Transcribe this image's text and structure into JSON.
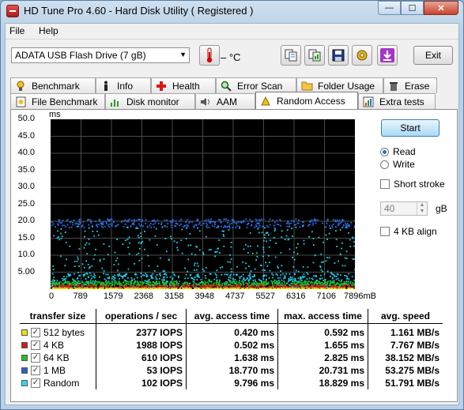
{
  "window": {
    "title": "HD Tune Pro 4.60 - Hard Disk Utility (  Registered )",
    "minimize_glyph": "—",
    "maximize_glyph": "☐",
    "close_glyph": "✕"
  },
  "menu": {
    "file_label": "File",
    "help_label": "Help"
  },
  "toolbar": {
    "drive_selected": "ADATA   USB Flash Drive  (7 gB)",
    "temperature": "– °C",
    "exit_label": "Exit",
    "icons": [
      "thermometer-icon",
      "copy-text-icon",
      "copy-screenshot-icon",
      "save-icon",
      "options-icon",
      "download-icon"
    ]
  },
  "tabs_top": [
    {
      "label": "Benchmark",
      "icon": "benchmark-icon"
    },
    {
      "label": "Info",
      "icon": "info-icon"
    },
    {
      "label": "Health",
      "icon": "health-icon"
    },
    {
      "label": "Error Scan",
      "icon": "error-scan-icon"
    },
    {
      "label": "Folder Usage",
      "icon": "folder-icon"
    },
    {
      "label": "Erase",
      "icon": "erase-icon"
    }
  ],
  "tabs_bottom": [
    {
      "label": "File Benchmark",
      "icon": "file-benchmark-icon"
    },
    {
      "label": "Disk monitor",
      "icon": "disk-monitor-icon"
    },
    {
      "label": "AAM",
      "icon": "aam-icon"
    },
    {
      "label": "Random Access",
      "icon": "random-access-icon",
      "active": true
    },
    {
      "label": "Extra tests",
      "icon": "extra-tests-icon"
    }
  ],
  "controls": {
    "start_label": "Start",
    "read_label": "Read",
    "write_label": "Write",
    "mode_selected": "Read",
    "short_stroke_label": "Short stroke",
    "short_stroke_checked": false,
    "short_stroke_value": "40",
    "short_stroke_unit": "gB",
    "align_label": "4 KB align",
    "align_checked": false
  },
  "chart_data": {
    "type": "scatter",
    "ylabel": "ms",
    "xlabel": "mB",
    "ylim": [
      0,
      50
    ],
    "xlim": [
      0,
      7896
    ],
    "grid": true,
    "y_ticks": [
      "50.0",
      "45.0",
      "40.0",
      "35.0",
      "30.0",
      "25.0",
      "20.0",
      "15.0",
      "10.0",
      "5.00"
    ],
    "x_ticks": [
      "0",
      "789",
      "1579",
      "2368",
      "3158",
      "3948",
      "4737",
      "5527",
      "6316",
      "7106",
      "7896mB"
    ],
    "series": [
      {
        "name": "512 bytes",
        "color": "#e8d800",
        "mean_ms": 0.42,
        "max_ms": 0.592
      },
      {
        "name": "4 KB",
        "color": "#d81818",
        "mean_ms": 0.502,
        "max_ms": 1.655
      },
      {
        "name": "64 KB",
        "color": "#18c018",
        "mean_ms": 1.638,
        "max_ms": 2.825
      },
      {
        "name": "1 MB",
        "color": "#2a6de0",
        "mean_ms": 18.77,
        "max_ms": 20.731
      },
      {
        "name": "Random",
        "color": "#20d0e8",
        "mean_ms": 9.796,
        "max_ms": 18.829
      }
    ]
  },
  "results": {
    "headers": [
      "transfer size",
      "operations / sec",
      "avg. access time",
      "max. access time",
      "avg. speed"
    ],
    "rows": [
      {
        "size": "512 bytes",
        "color": "#f0e000",
        "checked": true,
        "ops": "2377 IOPS",
        "avg": "0.420 ms",
        "max": "0.592 ms",
        "speed": "1.161 MB/s"
      },
      {
        "size": "4 KB",
        "color": "#d81818",
        "checked": true,
        "ops": "1988 IOPS",
        "avg": "0.502 ms",
        "max": "1.655 ms",
        "speed": "7.767 MB/s"
      },
      {
        "size": "64 KB",
        "color": "#20c020",
        "checked": true,
        "ops": "610 IOPS",
        "avg": "1.638 ms",
        "max": "2.825 ms",
        "speed": "38.152 MB/s"
      },
      {
        "size": "1 MB",
        "color": "#2a5fd0",
        "checked": true,
        "ops": "53 IOPS",
        "avg": "18.770 ms",
        "max": "20.731 ms",
        "speed": "53.275 MB/s"
      },
      {
        "size": "Random",
        "color": "#30d8f0",
        "checked": true,
        "ops": "102 IOPS",
        "avg": "9.796 ms",
        "max": "18.829 ms",
        "speed": "51.791 MB/s"
      }
    ]
  }
}
